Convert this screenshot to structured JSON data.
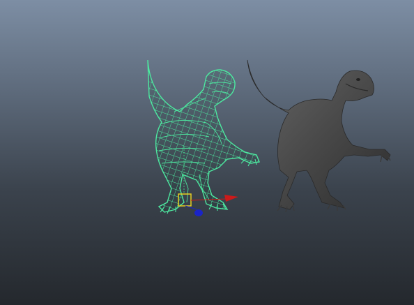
{
  "viewport": {
    "background_top": "#7d8ea4",
    "background_bottom": "#24282d"
  },
  "models": [
    {
      "name": "raptor-wireframe",
      "display": "wireframe",
      "selected": true,
      "color": "#4de8a0"
    },
    {
      "name": "raptor-shaded",
      "display": "shaded",
      "selected": false,
      "color": "#4a4a4a"
    }
  ],
  "manipulator": {
    "pivot_color": "#e8d020",
    "x_handle_color": "#cc1a1a",
    "z_handle_color": "#1a24c8",
    "y_axis_color": "#40c880"
  }
}
